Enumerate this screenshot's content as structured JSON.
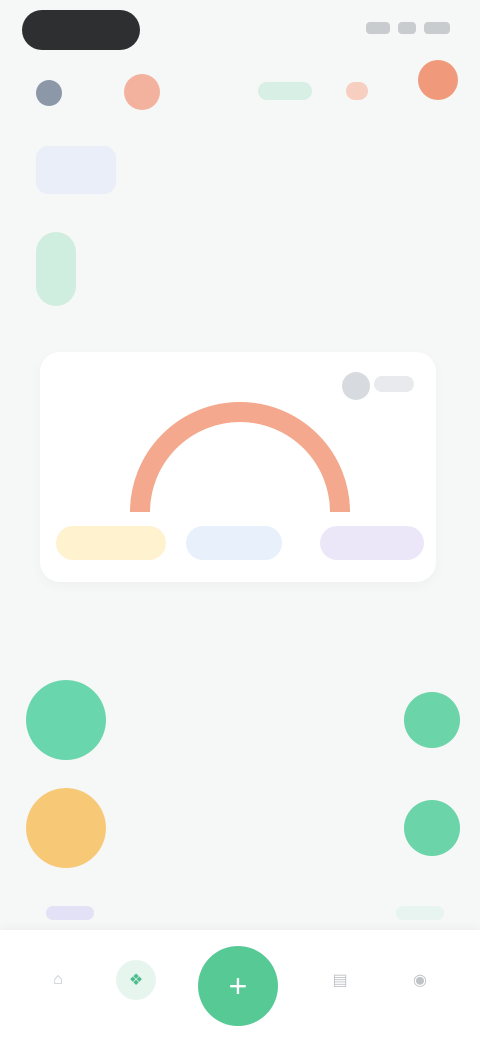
{
  "status": {},
  "header": {},
  "greeting": {
    "text": ""
  },
  "date_strip": {
    "days": [
      "",
      "",
      "",
      "",
      "",
      "",
      ""
    ]
  },
  "summary_card": {
    "left_label": "",
    "center_value": "",
    "chips": [
      "",
      "",
      ""
    ]
  },
  "section": {
    "title": "",
    "link": ""
  },
  "rows": [
    {
      "title": "",
      "subtitle": ""
    },
    {
      "title": "",
      "subtitle": ""
    }
  ],
  "tabbar": {
    "fab_label": "",
    "icons": [
      "home-icon",
      "leaf-icon",
      "plus-icon",
      "chart-icon",
      "profile-icon"
    ]
  },
  "colors": {
    "accent_green": "#56c995",
    "accent_orange": "#f19a7b",
    "chip_yellow": "#fff2cf",
    "chip_blue": "#e7f0fb",
    "chip_purple": "#ece7f8"
  }
}
